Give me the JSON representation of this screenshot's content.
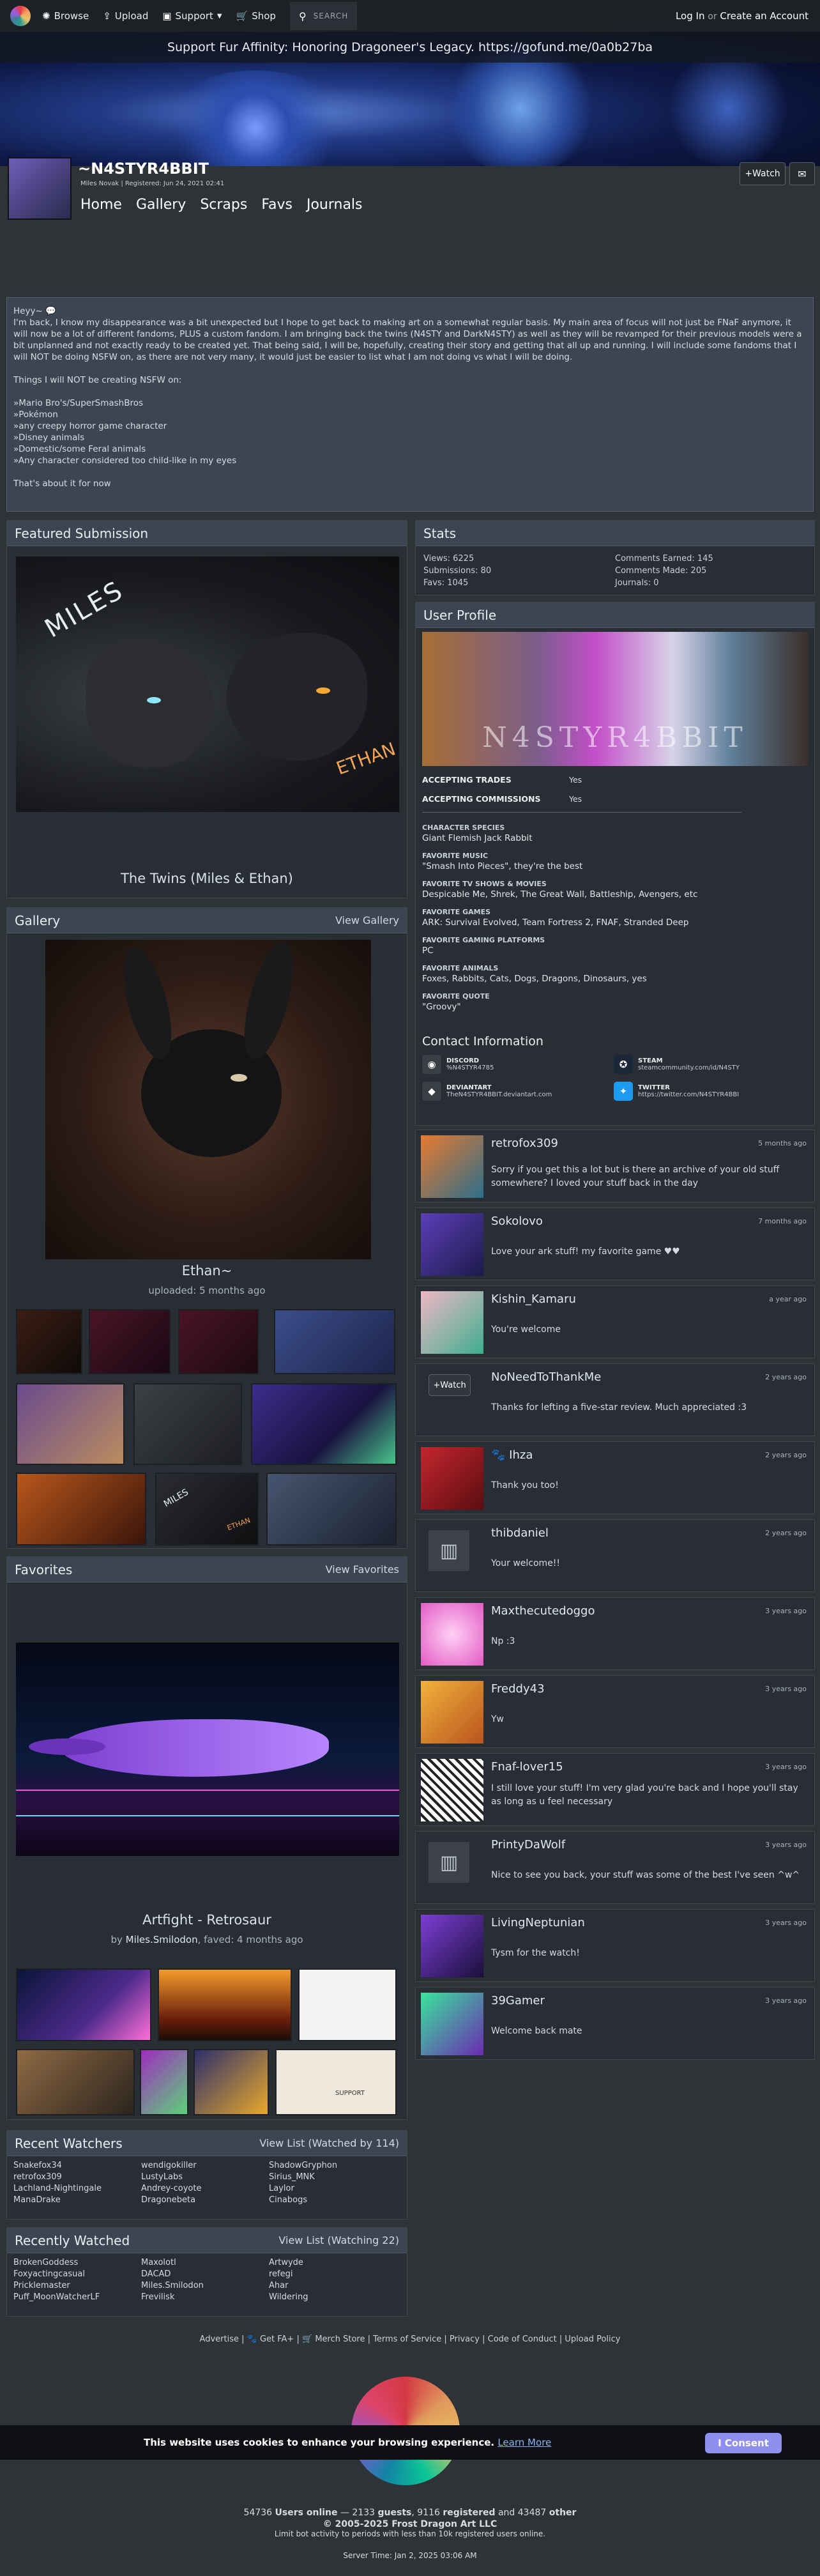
{
  "nav": {
    "browse": "Browse",
    "upload": "Upload",
    "support": "Support",
    "shop": "Shop",
    "search_placeholder": "SEARCH",
    "login": "Log In",
    "or": "or",
    "create_account": "Create an Account"
  },
  "announcement": "Support Fur Affinity: Honoring Dragoneer's Legacy. https://gofund.me/0a0b27ba",
  "profile_header": {
    "username": "~N4STYR4BBIT",
    "real_name": "Miles Novak",
    "registered": "Registered: Jun 24, 2021 02:41",
    "watch_label": "+Watch",
    "tabs": [
      "Home",
      "Gallery",
      "Scraps",
      "Favs",
      "Journals"
    ]
  },
  "bio": {
    "lines": [
      "Heyy~ 💬",
      "I'm back, I know my disappearance was a bit unexpected but I hope to get back to making art on a somewhat regular basis. My main area of focus will not just be FNaF anymore, it will now be a lot of different fandoms, PLUS a custom fandom. I am bringing back the twins (N4STY and DarkN4STY) as well as they will be revamped for their previous models were a bit unplanned and not exactly ready to be created yet. That being said, I will be, hopefully, creating their story and getting that all up and running. I will include some fandoms that I will NOT be doing NSFW on, as there are not very many, it would just be easier to list what I am not doing vs what I will be doing.",
      "",
      "Things I will NOT be creating NSFW on:",
      "",
      "»Mario Bro's/SuperSmashBros",
      "»Pokémon",
      "»any creepy horror game character",
      "»Disney animals",
      "»Domestic/some Feral animals",
      "»Any character considered too child-like in my eyes",
      "",
      "That's about it for now"
    ]
  },
  "featured": {
    "header": "Featured Submission",
    "title": "The Twins (Miles & Ethan)",
    "art_text_left": "MILES",
    "art_text_right": "ETHAN"
  },
  "gallery": {
    "header": "Gallery",
    "view_label": "View Gallery",
    "title": "Ethan~",
    "uploaded": "uploaded: 5 months ago",
    "thumb_text_1": "MILES",
    "thumb_text_2": "ETHAN"
  },
  "favorites": {
    "header": "Favorites",
    "view_label": "View Favorites",
    "title": "Artfight - Retrosaur",
    "by_label": "by",
    "artist": "Miles.Smilodon",
    "faved": ", faved: 4 months ago",
    "thumb_text": "SUPPORT"
  },
  "recent_watchers": {
    "header": "Recent Watchers",
    "view_label": "View List (Watched by 114)",
    "names": [
      "Snakefox34",
      "wendigokiller",
      "ShadowGryphon",
      "retrofox309",
      "LustyLabs",
      "Sirius_MNK",
      "Lachland-Nightingale",
      "Andrey-coyote",
      "Laylor",
      "ManaDrake",
      "Dragonebeta",
      "Cinabogs"
    ]
  },
  "recently_watched": {
    "header": "Recently Watched",
    "view_label": "View List (Watching 22)",
    "names": [
      "BrokenGoddess",
      "Maxolotl",
      "Artwyde",
      "Foxyactingcasual",
      "DACAD",
      "refegi",
      "Pricklemaster",
      "Miles.Smilodon",
      "Ahar",
      "Puff_MoonWatcherLF",
      "Frevilisk",
      "Wildering"
    ]
  },
  "stats": {
    "header": "Stats",
    "views": "Views: 6225",
    "submissions": "Submissions: 80",
    "favs": "Favs: 1045",
    "comments_earned": "Comments Earned: 145",
    "comments_made": "Comments Made: 205",
    "journals": "Journals: 0"
  },
  "user_profile": {
    "header": "User Profile",
    "banner_text": "N4STYR4BBIT",
    "accepting_trades_label": "ACCEPTING TRADES",
    "accepting_trades": "Yes",
    "accepting_commissions_label": "ACCEPTING COMMISSIONS",
    "accepting_commissions": "Yes",
    "fields": [
      {
        "label": "CHARACTER SPECIES",
        "value": "Giant Flemish Jack Rabbit"
      },
      {
        "label": "FAVORITE MUSIC",
        "value": "\"Smash Into Pieces\", they're the best"
      },
      {
        "label": "FAVORITE TV SHOWS & MOVIES",
        "value": "Despicable Me, Shrek, The Great Wall, Battleship, Avengers, etc"
      },
      {
        "label": "FAVORITE GAMES",
        "value": "ARK: Survival Evolved, Team Fortress 2, FNAF, Stranded Deep"
      },
      {
        "label": "FAVORITE GAMING PLATFORMS",
        "value": "PC"
      },
      {
        "label": "FAVORITE ANIMALS",
        "value": "Foxes, Rabbits, Cats, Dogs, Dragons, Dinosaurs, yes"
      },
      {
        "label": "FAVORITE QUOTE",
        "value": "\"Groovy\""
      }
    ],
    "contact_header": "Contact Information",
    "contacts": [
      {
        "label": "DISCORD",
        "value": "%N4STYR4785"
      },
      {
        "label": "STEAM",
        "value": "steamcommunity.com/id/N4STY"
      },
      {
        "label": "DEVIANTART",
        "value": "TheN4STYR4BBIT.deviantart.com"
      },
      {
        "label": "TWITTER",
        "value": "https://twitter.com/N4STYR4BBI"
      }
    ]
  },
  "comments": [
    {
      "name": "retrofox309",
      "date": "5 months ago",
      "text": "Sorry if you get this a lot but is there an archive of your old stuff somewhere? I loved your stuff back in the day"
    },
    {
      "name": "Sokolovo",
      "date": "7 months ago",
      "text": "Love your ark stuff! my favorite game ♥♥"
    },
    {
      "name": "Kishin_Kamaru",
      "date": "a year ago",
      "text": "You're welcome"
    },
    {
      "name": "NoNeedToThankMe",
      "date": "2 years ago",
      "text": "Thanks for lefting a five-star review. Much appreciated :3",
      "watch": "+Watch"
    },
    {
      "name": "Ihza",
      "date": "2 years ago",
      "text": "Thank you too!"
    },
    {
      "name": "thibdaniel",
      "date": "2 years ago",
      "text": "Your welcome!!"
    },
    {
      "name": "Maxthecutedoggo",
      "date": "3 years ago",
      "text": "Np :3"
    },
    {
      "name": "Freddy43",
      "date": "3 years ago",
      "text": "Yw"
    },
    {
      "name": "Fnaf-lover15",
      "date": "3 years ago",
      "text": "I still love your stuff! I'm very glad you're back and I hope you'll stay as long as u feel necessary"
    },
    {
      "name": "PrintyDaWolf",
      "date": "3 years ago",
      "text": "Nice to see you back, your stuff was some of the best I've seen ^w^"
    },
    {
      "name": "LivingNeptunian",
      "date": "3 years ago",
      "text": "Tysm for the watch!"
    },
    {
      "name": "39Gamer",
      "date": "3 years ago",
      "text": "Welcome back mate"
    }
  ],
  "footer": {
    "links": [
      "Advertise",
      "Get FA+",
      "Merch Store",
      "Terms of Service",
      "Privacy",
      "Code of Conduct",
      "Upload Policy"
    ],
    "users_online_num": "54736",
    "users_online_label": "Users online",
    "guests_num": "2133",
    "guests_label": "guests",
    "registered_num": "9116",
    "registered_label": "registered",
    "other_num": "43487",
    "other_label": "other",
    "copyright": "© 2005-2025 Frost Dragon Art LLC",
    "limit": "Limit bot activity to periods with less than 10k registered users online.",
    "server_time": "Server Time: Jan 2, 2025 03:06 AM"
  },
  "cookie": {
    "text": "This website uses cookies to enhance your browsing experience.",
    "learn_more": "Learn More",
    "consent": "I Consent"
  },
  "colors": {
    "page_bg": "#2e3338",
    "panel_header": "#3b4652",
    "accent_button": "#8f8ff0"
  }
}
